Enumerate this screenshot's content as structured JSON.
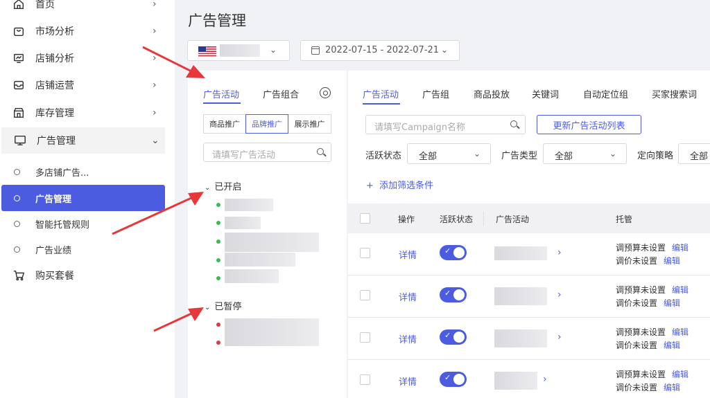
{
  "sidebar": {
    "items": [
      {
        "label": "首页",
        "icon": "home-icon"
      },
      {
        "label": "市场分析",
        "icon": "bag-icon"
      },
      {
        "label": "店铺分析",
        "icon": "chart-monitor-icon"
      },
      {
        "label": "店铺运营",
        "icon": "inbox-icon"
      },
      {
        "label": "库存管理",
        "icon": "store-icon"
      },
      {
        "label": "广告管理",
        "icon": "monitor-icon"
      }
    ],
    "sub_items": [
      {
        "label": "多店铺广告..."
      },
      {
        "label": "广告管理"
      },
      {
        "label": "智能托管规则"
      },
      {
        "label": "广告业绩"
      }
    ],
    "bottom": {
      "label": "购买套餐",
      "icon": "cart-icon"
    }
  },
  "page": {
    "title": "广告管理"
  },
  "filters": {
    "country_flag": "us-flag",
    "date_range": "2022-07-15 - 2022-07-21"
  },
  "left_panel": {
    "tabs": [
      "广告活动",
      "广告组合"
    ],
    "segments": [
      "商品推广",
      "品牌推广",
      "展示推广"
    ],
    "search_placeholder": "请填写广告活动",
    "group_enabled": "已开启",
    "group_paused": "已暂停"
  },
  "right_panel": {
    "tabs": [
      "广告活动",
      "广告组",
      "商品投放",
      "关键词",
      "自动定位组",
      "买家搜索词"
    ],
    "search_placeholder": "请填写Campaign名称",
    "refresh_button": "更新广告活动列表",
    "filter_labels": [
      "活跃状态",
      "广告类型",
      "定向策略"
    ],
    "filter_values": [
      "全部",
      "全部",
      "全部"
    ],
    "add_filter": "添加筛选条件",
    "columns": [
      "操作",
      "活跃状态",
      "广告活动",
      "托管"
    ],
    "rows": [
      {
        "action": "详情",
        "budget": "调预算未设置",
        "price": "调价未设置",
        "edit": "编辑"
      },
      {
        "action": "详情",
        "budget": "调预算未设置",
        "price": "调价未设置",
        "edit": "编辑"
      },
      {
        "action": "详情",
        "budget": "调预算未设置",
        "price": "调价未设置",
        "edit": "编辑"
      },
      {
        "action": "详情",
        "budget": "调预算未设置",
        "price": "调价未设置",
        "edit": "编辑"
      }
    ]
  },
  "colors": {
    "accent": "#4c5ce0",
    "annotation": "#e8363a",
    "active_dot": "#3cb95a",
    "paused_dot": "#e0383e"
  }
}
